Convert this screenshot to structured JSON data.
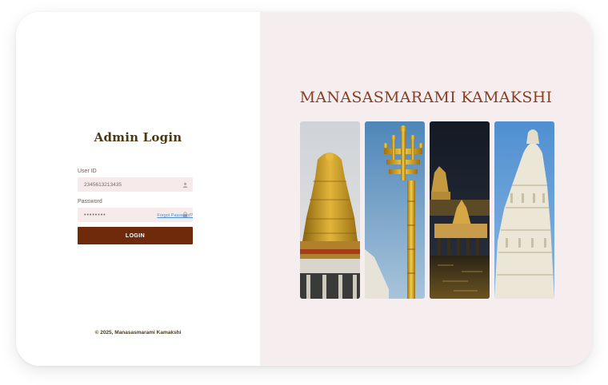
{
  "login": {
    "title": "Admin Login",
    "user_label": "User ID",
    "user_value": "2345613213435",
    "password_label": "Password",
    "password_value": "••••••••",
    "forgot_label": "Forgot Password?",
    "button_label": "LOGIN"
  },
  "footer": {
    "text": "© 2025, Manasasmarami Kamakshi"
  },
  "brand": {
    "title": "MANASASMARAMI KAMAKSHI"
  },
  "gallery": {
    "images": [
      {
        "icon": "golden-gopuram-image"
      },
      {
        "icon": "golden-flagstaff-image"
      },
      {
        "icon": "temple-tank-night-image"
      },
      {
        "icon": "white-gopuram-image"
      }
    ]
  },
  "colors": {
    "accent": "#6f2a0c",
    "title": "#4a3a12",
    "brand": "#8a3d22",
    "right_bg": "#f6eeee",
    "field_bg": "#f6eaea",
    "link": "#4a8fd6"
  }
}
